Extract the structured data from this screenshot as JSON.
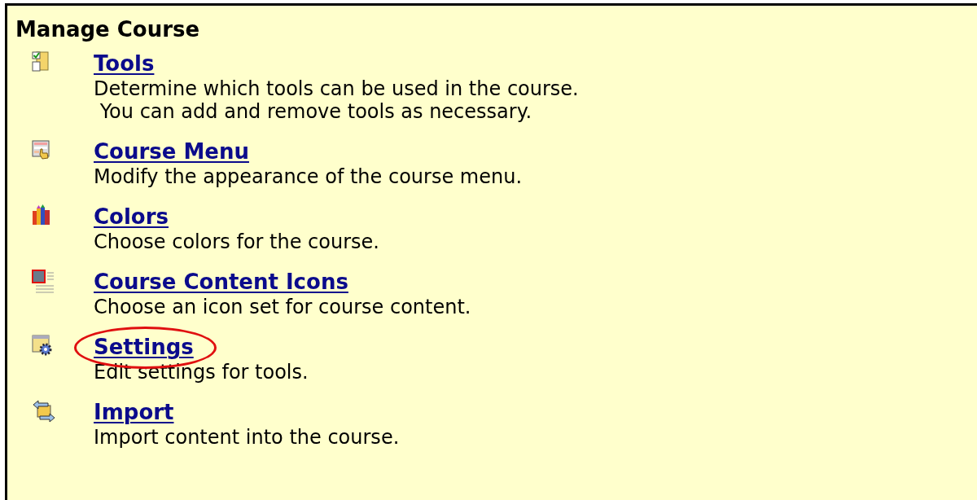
{
  "panel": {
    "title": "Manage Course"
  },
  "items": [
    {
      "kind": "tools",
      "title": "Tools",
      "description": [
        "Determine which tools can be used in the course.",
        " You can add and remove tools as necessary."
      ],
      "highlighted": false
    },
    {
      "kind": "menu",
      "title": "Course Menu",
      "description": [
        "Modify the appearance of the course menu."
      ],
      "highlighted": false
    },
    {
      "kind": "colors",
      "title": "Colors",
      "description": [
        "Choose colors for the course."
      ],
      "highlighted": false
    },
    {
      "kind": "icons",
      "title": "Course Content Icons",
      "description": [
        "Choose an icon set for course content."
      ],
      "highlighted": false
    },
    {
      "kind": "settings",
      "title": "Settings",
      "description": [
        "Edit settings for tools."
      ],
      "highlighted": true
    },
    {
      "kind": "import",
      "title": "Import",
      "description": [
        "Import content into the course."
      ],
      "highlighted": false
    }
  ]
}
